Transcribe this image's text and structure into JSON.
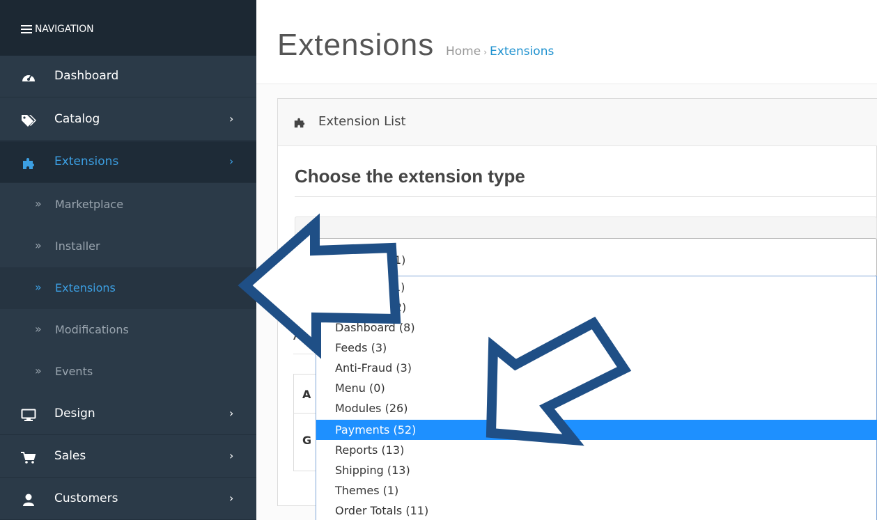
{
  "sidebar": {
    "header": "NAVIGATION",
    "items": [
      {
        "label": "Dashboard",
        "icon": "dashboard-icon",
        "has_children": false
      },
      {
        "label": "Catalog",
        "icon": "tags-icon",
        "has_children": true
      },
      {
        "label": "Extensions",
        "icon": "puzzle-icon",
        "has_children": true,
        "active": true
      },
      {
        "label": "Design",
        "icon": "desktop-icon",
        "has_children": true
      },
      {
        "label": "Sales",
        "icon": "cart-icon",
        "has_children": true
      },
      {
        "label": "Customers",
        "icon": "user-icon",
        "has_children": true
      }
    ],
    "submenu": [
      {
        "label": "Marketplace"
      },
      {
        "label": "Installer"
      },
      {
        "label": "Extensions",
        "active": true
      },
      {
        "label": "Modifications"
      },
      {
        "label": "Events"
      }
    ],
    "chevron": "›",
    "bullet": "»"
  },
  "header": {
    "title": "Extensions",
    "breadcrumb": [
      "Home",
      "Extensions"
    ],
    "breadcrumb_sep": "›"
  },
  "panel": {
    "title": "Extension List",
    "choose_title": "Choose the extension type",
    "select_value": "Analytics (1)",
    "background_heading": "A",
    "background_row1": "A",
    "background_row2": "G"
  },
  "dropdown": {
    "options": [
      "Analytics (1)",
      "Captchas (2)",
      "Dashboard (8)",
      "Feeds (3)",
      "Anti-Fraud (3)",
      "Menu (0)",
      "Modules (26)",
      "Payments (52)",
      "Reports (13)",
      "Shipping (13)",
      "Themes (1)",
      "Order Totals (11)"
    ],
    "selected_index": 7
  },
  "colors": {
    "sidebar_bg": "#2b3a48",
    "active_blue": "#3c9fe2",
    "selected_option": "#1e90ff",
    "arrow_fill": "#ffffff",
    "arrow_stroke": "#1f4f86"
  }
}
